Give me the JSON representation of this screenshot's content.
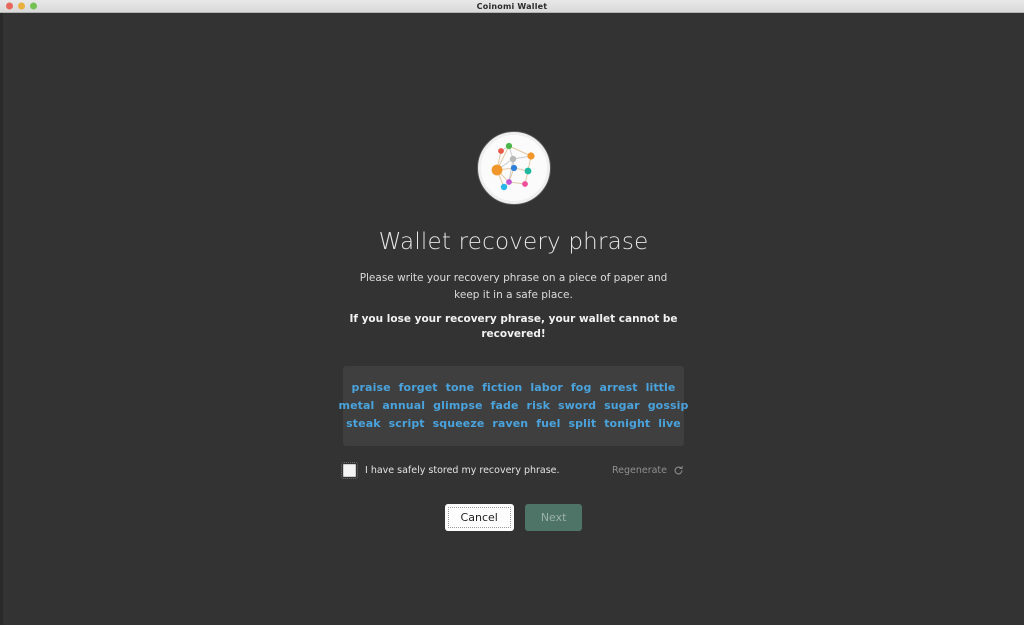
{
  "window": {
    "title": "Coinomi Wallet",
    "traffic_lights": [
      "close",
      "minimize",
      "zoom"
    ]
  },
  "branding": {
    "logo_name": "coinomi-network-logo",
    "logo_colors": {
      "orange": "#f0962b",
      "green": "#4cb749",
      "red": "#e8594a",
      "teal": "#1fb7a0",
      "blue": "#2f7ed8",
      "pink": "#ef4f9a",
      "cyan": "#29b6e8",
      "gray": "#b8b8b8",
      "magenta": "#c354d4"
    }
  },
  "main": {
    "title": "Wallet recovery phrase",
    "subtitle": "Please write your recovery phrase on a piece of paper and keep it in a safe place.",
    "warning": "If you lose your recovery phrase, your wallet cannot be recovered!",
    "recovery_phrase": {
      "word_color": "#4aa3dd",
      "rows": [
        [
          "praise",
          "forget",
          "tone",
          "fiction",
          "labor",
          "fog",
          "arrest",
          "little"
        ],
        [
          "metal",
          "annual",
          "glimpse",
          "fade",
          "risk",
          "sword",
          "sugar",
          "gossip"
        ],
        [
          "steak",
          "script",
          "squeeze",
          "raven",
          "fuel",
          "split",
          "tonight",
          "live"
        ]
      ],
      "words": [
        "praise",
        "forget",
        "tone",
        "fiction",
        "labor",
        "fog",
        "arrest",
        "little",
        "metal",
        "annual",
        "glimpse",
        "fade",
        "risk",
        "sword",
        "sugar",
        "gossip",
        "steak",
        "script",
        "squeeze",
        "raven",
        "fuel",
        "split",
        "tonight",
        "live"
      ],
      "word_count": 24
    },
    "confirm": {
      "checkbox_label": "I have safely stored my recovery phrase.",
      "checked": false
    },
    "regenerate": {
      "label": "Regenerate",
      "icon": "refresh-icon"
    },
    "buttons": {
      "cancel": "Cancel",
      "next": "Next",
      "next_enabled": false,
      "next_color": "#4e7468"
    }
  }
}
